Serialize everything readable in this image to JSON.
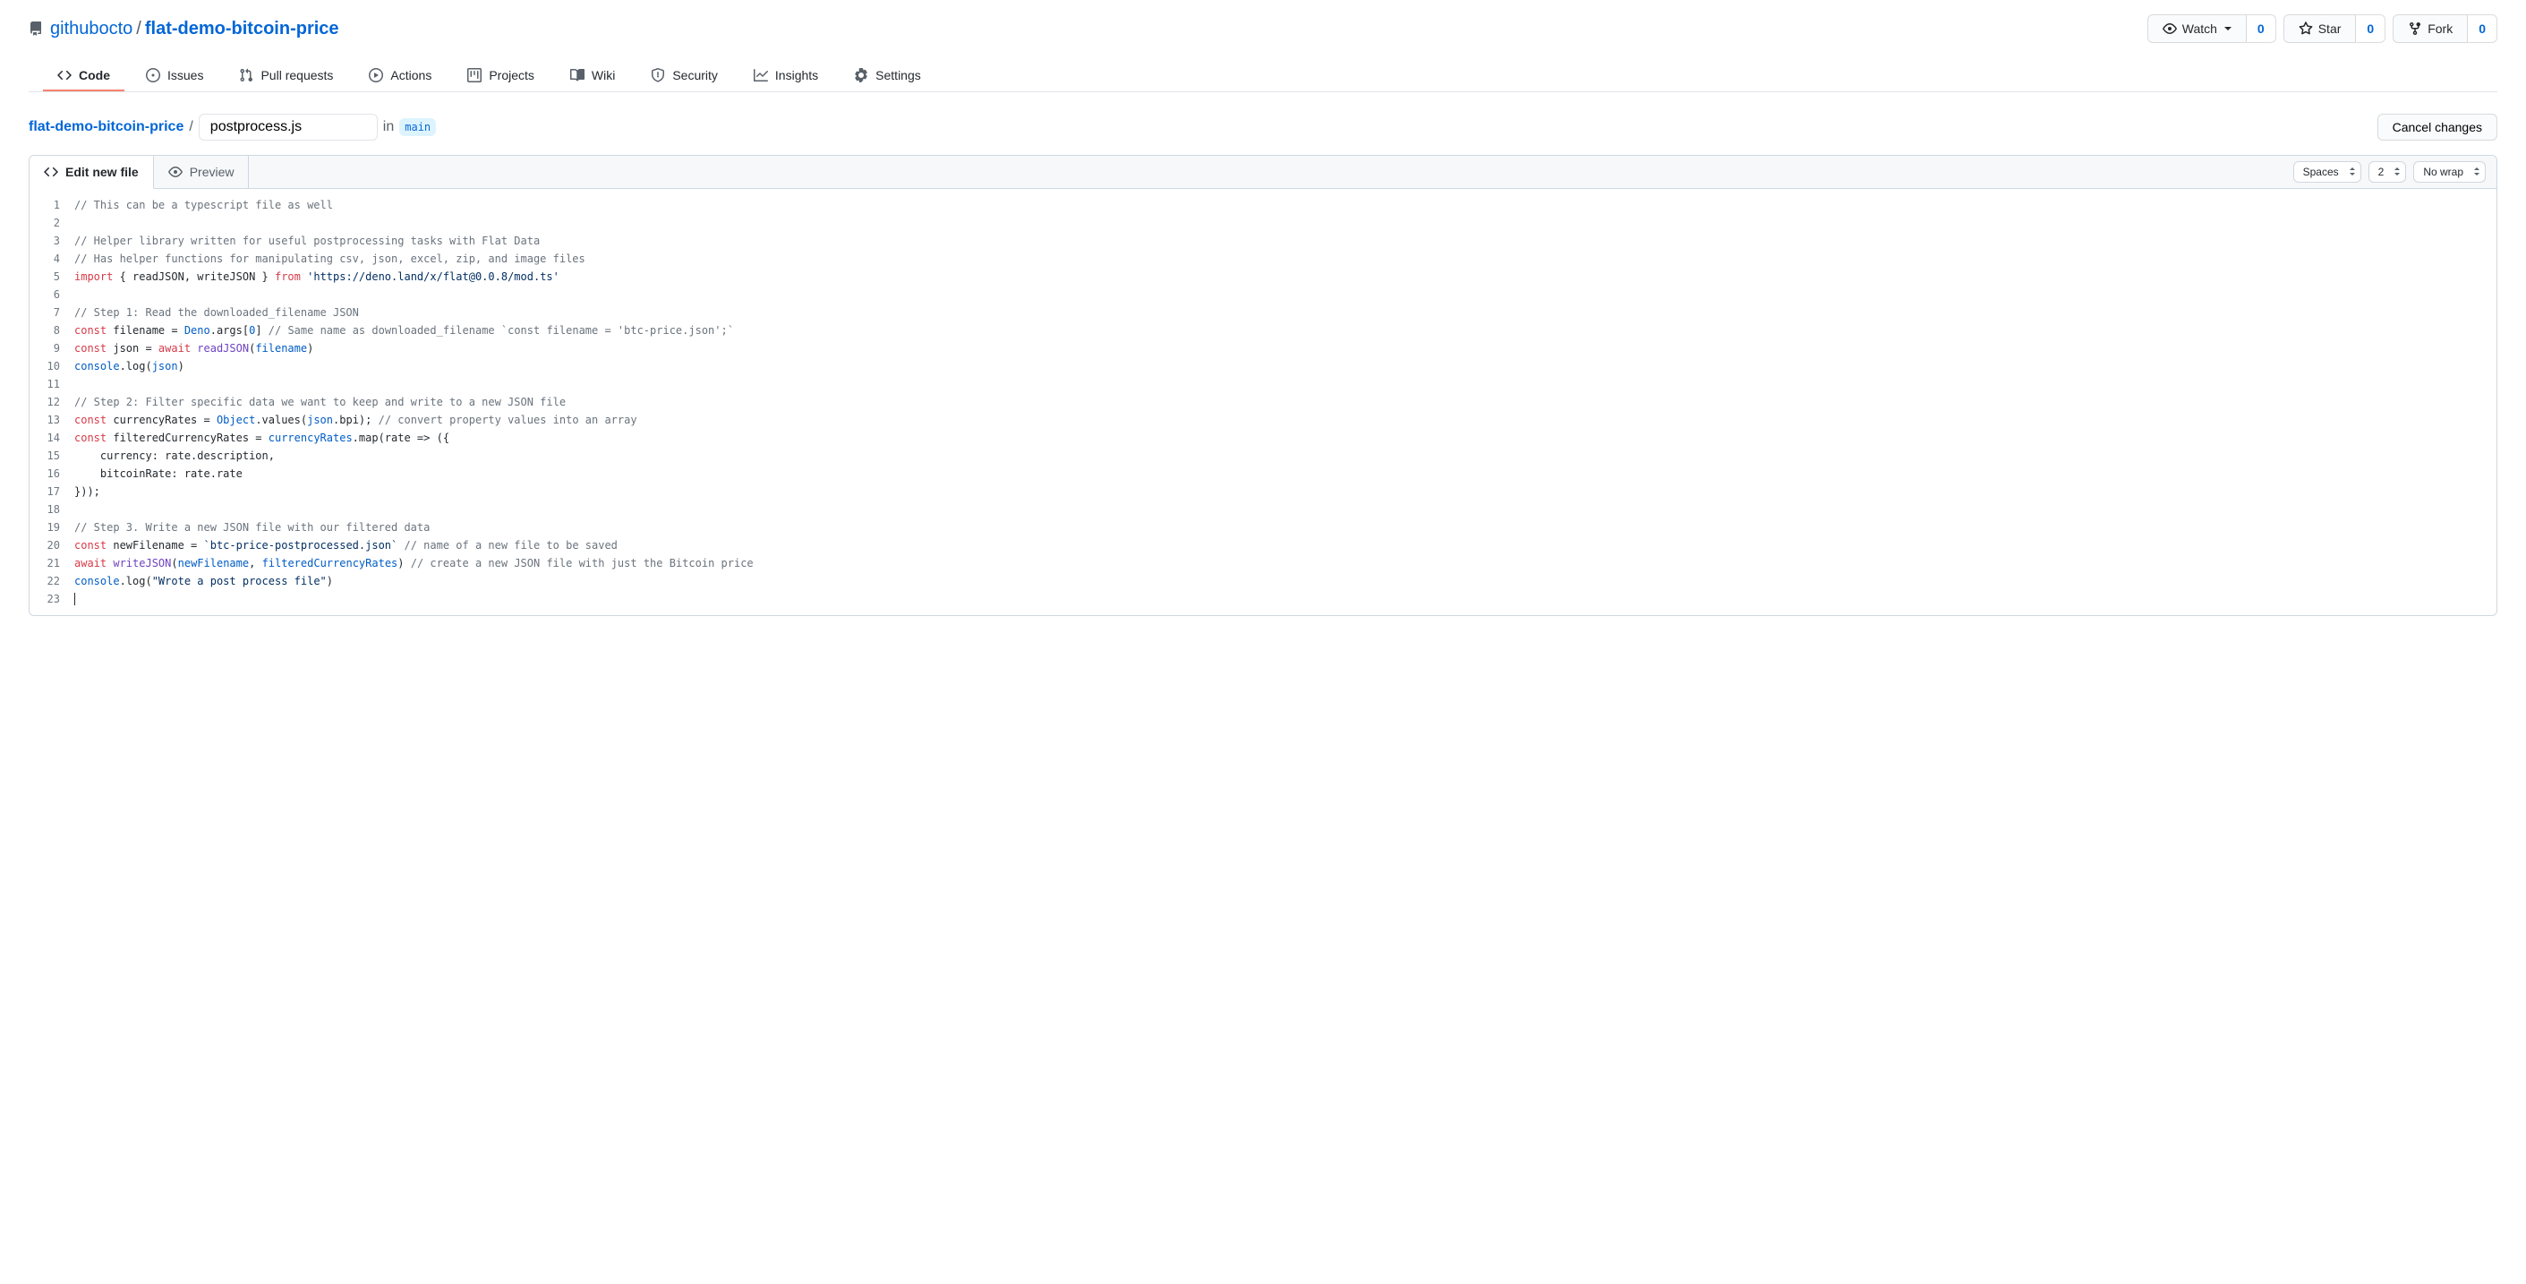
{
  "repo": {
    "owner": "githubocto",
    "name": "flat-demo-bitcoin-price"
  },
  "actions": {
    "watch": {
      "label": "Watch",
      "count": "0"
    },
    "star": {
      "label": "Star",
      "count": "0"
    },
    "fork": {
      "label": "Fork",
      "count": "0"
    }
  },
  "nav": {
    "code": "Code",
    "issues": "Issues",
    "pulls": "Pull requests",
    "actions": "Actions",
    "projects": "Projects",
    "wiki": "Wiki",
    "security": "Security",
    "insights": "Insights",
    "settings": "Settings"
  },
  "file": {
    "root": "flat-demo-bitcoin-price",
    "filename": "postprocess.js",
    "in_text": "in",
    "branch": "main",
    "cancel": "Cancel changes"
  },
  "editor": {
    "tab_edit": "Edit new file",
    "tab_preview": "Preview",
    "indent_mode": "Spaces",
    "indent_size": "2",
    "wrap": "No wrap"
  },
  "code": {
    "line_count": 23,
    "l1_comment": "// This can be a typescript file as well",
    "l3_comment": "// Helper library written for useful postprocessing tasks with Flat Data",
    "l4_comment": "// Has helper functions for manipulating csv, json, excel, zip, and image files",
    "l5": {
      "import": "import",
      "braces": " { readJSON, writeJSON } ",
      "from": "from",
      "str": " 'https://deno.land/x/flat@0.0.8/mod.ts'"
    },
    "l7_comment": "// Step 1: Read the downloaded_filename JSON",
    "l8": {
      "const": "const",
      "filename_eq": " filename = ",
      "deno": "Deno",
      "args": ".args[",
      "zero": "0",
      "close": "] ",
      "comment": "// Same name as downloaded_filename `const filename = 'btc-price.json';`"
    },
    "l9": {
      "const": "const",
      "json_eq": " json = ",
      "await": "await",
      "sp": " ",
      "readJSON": "readJSON",
      "open": "(",
      "filename": "filename",
      "close": ")"
    },
    "l10": {
      "console": "console",
      "log": ".log(",
      "json": "json",
      "close": ")"
    },
    "l12_comment": "// Step 2: Filter specific data we want to keep and write to a new JSON file",
    "l13": {
      "const": "const",
      "cr_eq": " currencyRates = ",
      "object": "Object",
      "values": ".values(",
      "json": "json",
      "bpi": ".bpi); ",
      "comment": "// convert property values into an array"
    },
    "l14": {
      "const": "const",
      "fcr_eq": " filteredCurrencyRates = ",
      "cr": "currencyRates",
      "map": ".map(rate => ({"
    },
    "l15": "    currency: rate.description,",
    "l16": "    bitcoinRate: rate.rate",
    "l17": "}));",
    "l19_comment": "// Step 3. Write a new JSON file with our filtered data",
    "l20": {
      "const": "const",
      "nf_eq": " newFilename = ",
      "str": "`btc-price-postprocessed.json`",
      "sp": " ",
      "comment": "// name of a new file to be saved"
    },
    "l21": {
      "await": "await",
      "sp": " ",
      "writeJSON": "writeJSON",
      "open": "(",
      "newFilename": "newFilename",
      "comma": ", ",
      "fcr": "filteredCurrencyRates",
      "close": ") ",
      "comment": "// create a new JSON file with just the Bitcoin price"
    },
    "l22": {
      "console": "console",
      "log": ".log(",
      "str": "\"Wrote a post process file\"",
      "close": ")"
    }
  }
}
